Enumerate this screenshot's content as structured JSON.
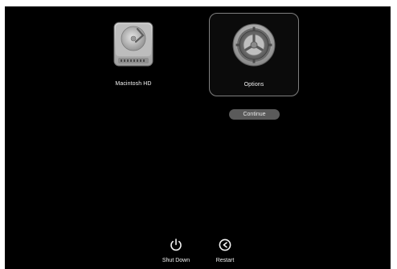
{
  "startup_options": {
    "volumes": [
      {
        "name": "Macintosh HD",
        "icon": "hard-drive-icon",
        "selected": false
      },
      {
        "name": "Options",
        "icon": "gear-icon",
        "selected": true
      }
    ],
    "continue_label": "Continue"
  },
  "bottom_bar": {
    "shutdown_label": "Shut Down",
    "shutdown_icon": "power-icon",
    "restart_label": "Restart",
    "restart_icon": "restart-icon"
  },
  "colors": {
    "background": "#000000",
    "selected_border": "#7f7f7f",
    "button_fill": "#5a5a5a",
    "text": "#f2f2f2"
  }
}
